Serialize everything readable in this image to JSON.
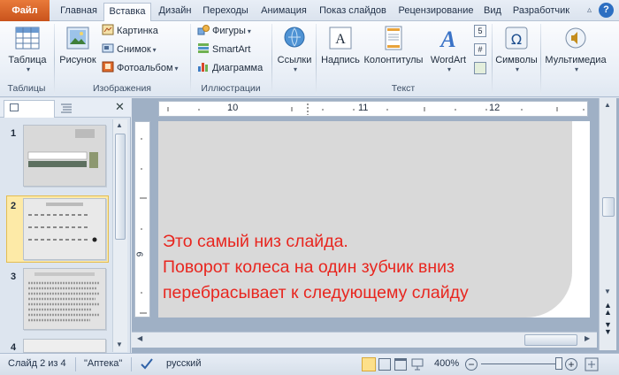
{
  "tabs": {
    "file": "Файл",
    "home": "Главная",
    "insert": "Вставка",
    "design": "Дизайн",
    "transitions": "Переходы",
    "animations": "Анимация",
    "slideshow": "Показ слайдов",
    "review": "Рецензирование",
    "view": "Вид",
    "developer": "Разработчик"
  },
  "ribbon": {
    "tables": {
      "table": "Таблица",
      "group": "Таблицы"
    },
    "images": {
      "picture": "Рисунок",
      "clipart": "Картинка",
      "screenshot": "Снимок",
      "album": "Фотоальбом",
      "group": "Изображения"
    },
    "illustrations": {
      "shapes": "Фигуры",
      "smartart": "SmartArt",
      "chart": "Диаграмма",
      "group": "Иллюстрации"
    },
    "links": {
      "links": "Ссылки"
    },
    "text": {
      "textbox": "Надпись",
      "headerfooter": "Колонтитулы",
      "wordart": "WordArt",
      "group": "Текст"
    },
    "symbols": {
      "symbols": "Символы"
    },
    "media": {
      "media": "Мультимедиа"
    }
  },
  "slides": [
    {
      "num": "1"
    },
    {
      "num": "2"
    },
    {
      "num": "3"
    },
    {
      "num": "4"
    }
  ],
  "ruler": {
    "h10": "10",
    "h11": "11",
    "h12": "12",
    "v9": "9"
  },
  "slide_content": {
    "line1": "Это самый низ слайда.",
    "line2": "Поворот колеса на один зубчик вниз",
    "line3": "перебрасывает к следующему слайду"
  },
  "status": {
    "slide_info": "Слайд 2 из 4",
    "theme": "\"Аптека\"",
    "language": "русский",
    "zoom": "400%"
  },
  "colors": {
    "file_tab": "#d2622a",
    "slide_text": "#e8261f",
    "selection": "#fdeaa7"
  }
}
